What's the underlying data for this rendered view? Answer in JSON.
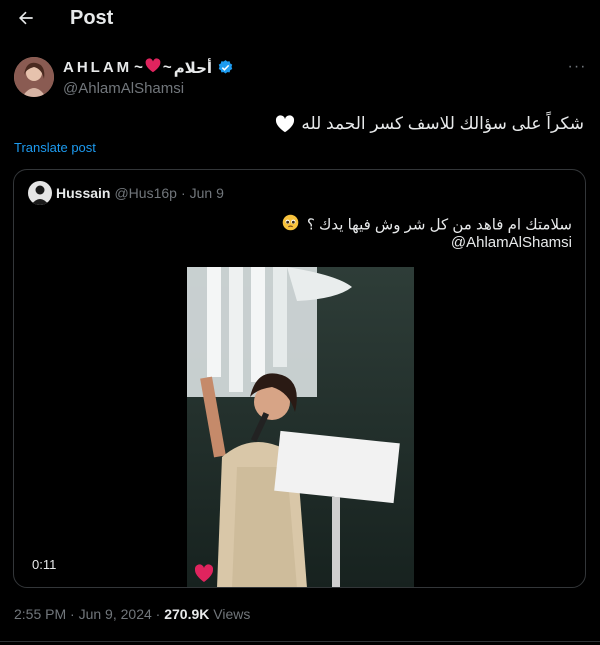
{
  "header": {
    "title": "Post",
    "back_icon": "arrow-left-icon"
  },
  "author": {
    "display_name_latin": "AHLAM",
    "display_name_sep1": "~",
    "display_name_sep2": "~",
    "display_name_arabic": "أحلام",
    "handle": "@AhlamAlShamsi",
    "verified": true,
    "heart_color": "#e0245e",
    "verified_color": "#1d9bf0"
  },
  "more_icon": "more-horizontal-icon",
  "tweet": {
    "text": "شكراً على سؤالك للاسف كسر الحمد لله",
    "translate_label": "Translate post"
  },
  "quote": {
    "name": "Hussain",
    "handle": "@Hus16p",
    "separator": "·",
    "date": "Jun 9",
    "text": "سلامتك ام فاهد من كل شر وش فيها يدك ؟",
    "emoji": "pleading-face-icon",
    "mention": "@AhlamAlShamsi",
    "video": {
      "duration": "0:11"
    }
  },
  "meta": {
    "time": "2:55 PM",
    "separator": "·",
    "date": "Jun 9, 2024",
    "views_count": "270.9K",
    "views_label": "Views"
  },
  "colors": {
    "background": "#000000",
    "text": "#e7e9ea",
    "secondary": "#71767b",
    "link": "#1d9bf0",
    "border": "#333639"
  }
}
